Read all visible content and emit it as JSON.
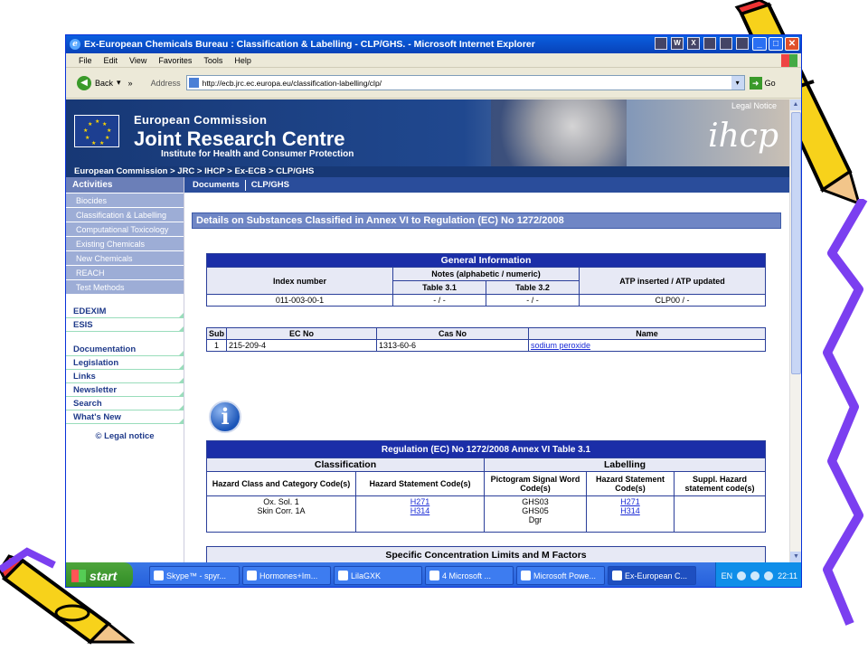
{
  "window": {
    "title": "Ex-European Chemicals Bureau : Classification & Labelling - CLP/GHS. - Microsoft Internet Explorer"
  },
  "menu": [
    "File",
    "Edit",
    "View",
    "Favorites",
    "Tools",
    "Help"
  ],
  "toolbar": {
    "back_label": "Back",
    "address_label": "Address",
    "url": "http://ecb.jrc.ec.europa.eu/classification-labelling/clp/",
    "go_label": "Go"
  },
  "banner": {
    "legal_notice": "Legal Notice",
    "ec": "European Commission",
    "jrc": "Joint Research Centre",
    "institute": "Institute for Health and Consumer Protection",
    "logo_text": "ihcp",
    "breadcrumb": "European Commission  >  JRC  >  IHCP  >  Ex-ECB  >  CLP/GHS"
  },
  "leftnav": {
    "activities_header": "Activities",
    "activities": [
      "Biocides",
      "Classification & Labelling",
      "Computational Toxicology",
      "Existing Chemicals",
      "New Chemicals",
      "REACH",
      "Test Methods"
    ],
    "group1": [
      "EDEXIM",
      "ESIS"
    ],
    "group2": [
      "Documentation",
      "Legislation",
      "Links",
      "Newsletter",
      "Search",
      "What's New"
    ],
    "legal": "© Legal notice"
  },
  "tabs": [
    "Documents",
    "CLP/GHS"
  ],
  "page_heading": "Details on Substances Classified in Annex VI to Regulation (EC) No 1272/2008",
  "general_info": {
    "title": "General Information",
    "col_index": "Index number",
    "col_notes": "Notes (alphabetic / numeric)",
    "col_table31": "Table 3.1",
    "col_table32": "Table 3.2",
    "col_atp": "ATP inserted / ATP updated",
    "index_number": "011-003-00-1",
    "notes_31": "- / -",
    "notes_32": "- / -",
    "atp": "CLP00 / -"
  },
  "substance": {
    "col_sub": "Sub",
    "col_ec": "EC No",
    "col_cas": "Cas No",
    "col_name": "Name",
    "sub": "1",
    "ec_no": "215-209-4",
    "cas_no": "1313-60-6",
    "name": "sodium peroxide"
  },
  "annex_table": {
    "title": "Regulation (EC) No 1272/2008 Annex VI Table 3.1",
    "classification": "Classification",
    "labelling": "Labelling",
    "col_hazard_class": "Hazard Class and Category Code(s)",
    "col_hazard_stmt": "Hazard Statement Code(s)",
    "col_pictogram": "Pictogram Signal Word Code(s)",
    "col_hazard_stmt2": "Hazard Statement Code(s)",
    "col_suppl": "Suppl. Hazard statement code(s)",
    "hazard_class_1": "Ox. Sol. 1",
    "hazard_class_2": "Skin Corr. 1A",
    "h_codes": [
      "H271",
      "H314"
    ],
    "pictograms": [
      "GHS03",
      "GHS05",
      "Dgr"
    ],
    "label_h_codes": [
      "H271",
      "H314"
    ]
  },
  "scl_table": {
    "title": "Specific Concentration Limits and M Factors"
  },
  "taskbar": {
    "start": "start",
    "tasks": [
      "Skype™ - spyr...",
      "Hormones+Im...",
      "LilaGXK",
      "4 Microsoft ...",
      "Microsoft Powe...",
      "Ex-European C..."
    ],
    "lang": "EN",
    "clock": "22:11"
  },
  "colors": {
    "accent": "#1b2ea8",
    "nav_bg": "#9dadd6",
    "title_bar": "#0a5fe0"
  }
}
